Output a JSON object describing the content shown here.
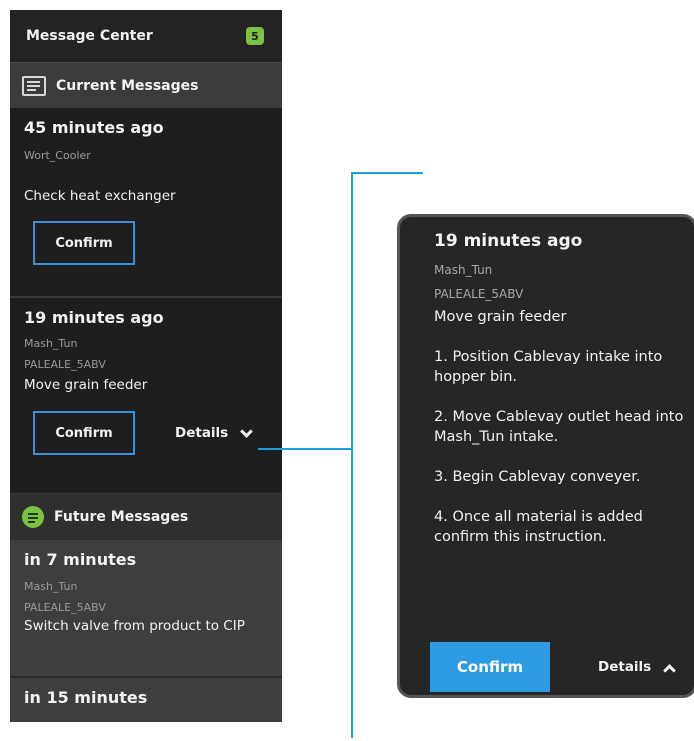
{
  "header": {
    "title": "Message Center",
    "badge": "5"
  },
  "sections": {
    "current": "Current Messages",
    "future": "Future Messages"
  },
  "current_messages": [
    {
      "time": "45 minutes ago",
      "equipment": "Wort_Cooler",
      "text": "Check heat exchanger",
      "confirm": "Confirm"
    },
    {
      "time": "19 minutes ago",
      "equipment": "Mash_Tun",
      "recipe": "PALEALE_5ABV",
      "text": "Move grain feeder",
      "confirm": "Confirm",
      "details": "Details"
    }
  ],
  "future_messages": [
    {
      "time": "in 7 minutes",
      "equipment": "Mash_Tun",
      "recipe": "PALEALE_5ABV",
      "text": "Switch valve from product to CIP"
    },
    {
      "time": "in 15 minutes"
    }
  ],
  "expanded": {
    "time": "19 minutes ago",
    "equipment": "Mash_Tun",
    "recipe": "PALEALE_5ABV",
    "text": "Move grain feeder",
    "steps": [
      "1. Position Cablevay intake into hopper bin.",
      "2. Move Cablevay outlet head into Mash_Tun intake.",
      "3. Begin Cablevay conveyer.",
      "4. Once all material is added confirm this instruction."
    ],
    "confirm": "Confirm",
    "details": "Details"
  },
  "colors": {
    "accent_blue": "#2c9be3",
    "badge_green": "#7ec242",
    "panel_bg": "#272727",
    "connector": "#1e9ed8"
  }
}
